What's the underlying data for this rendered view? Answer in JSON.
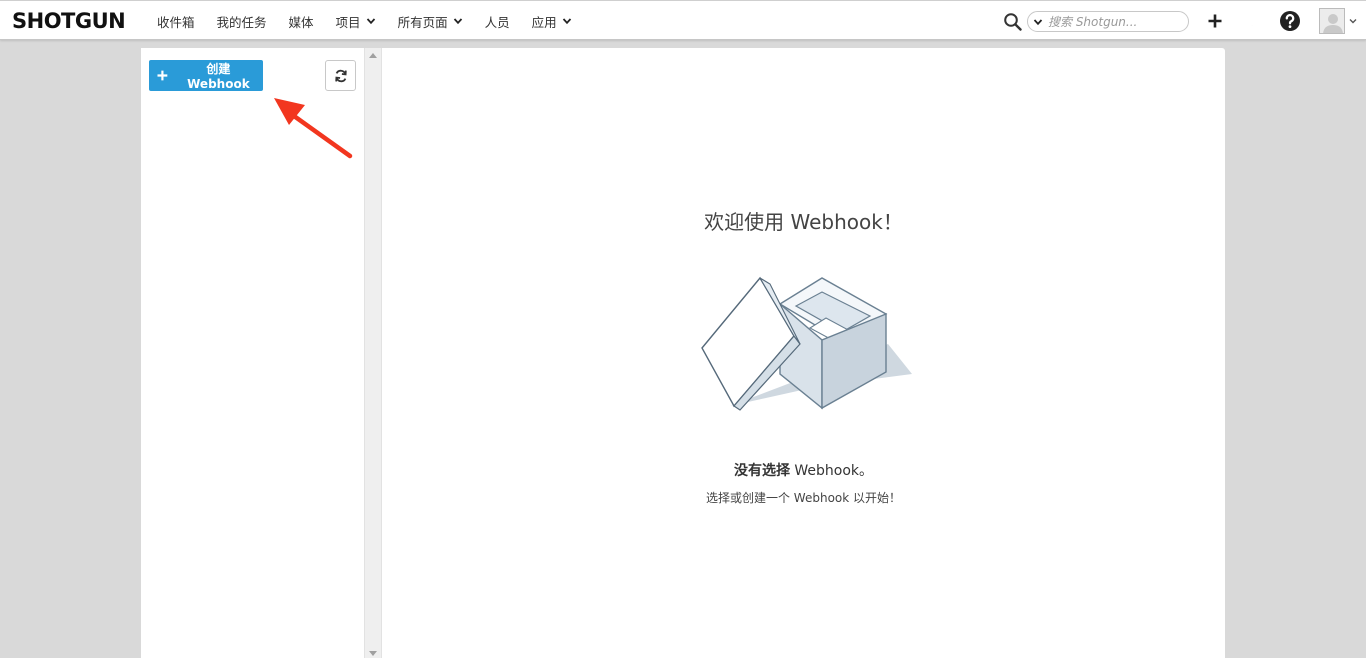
{
  "header": {
    "logo": "SHOTGUN",
    "nav": [
      {
        "label": "收件箱",
        "dropdown": false
      },
      {
        "label": "我的任务",
        "dropdown": false
      },
      {
        "label": "媒体",
        "dropdown": false
      },
      {
        "label": "项目",
        "dropdown": true
      },
      {
        "label": "所有页面",
        "dropdown": true
      },
      {
        "label": "人员",
        "dropdown": false
      },
      {
        "label": "应用",
        "dropdown": true
      }
    ],
    "search_placeholder": "搜索 Shotgun...",
    "icons": [
      "search-icon",
      "plus-icon",
      "moon-icon",
      "help-icon",
      "avatar"
    ]
  },
  "sidebar": {
    "create_label": "创建 Webhook",
    "refresh_icon": "refresh-icon",
    "accent_color": "#2a9bd8"
  },
  "main": {
    "welcome_prefix": "欢迎使用",
    "welcome_name": "Webhook",
    "welcome_suffix": "！",
    "empty_bold": "没有选择",
    "empty_name": "Webhook。",
    "empty_sub_prefix": "选择或创建一个",
    "empty_sub_link": "Webhook",
    "empty_sub_suffix": "以开始！"
  },
  "annotation": {
    "arrow_color": "#f2361f"
  }
}
